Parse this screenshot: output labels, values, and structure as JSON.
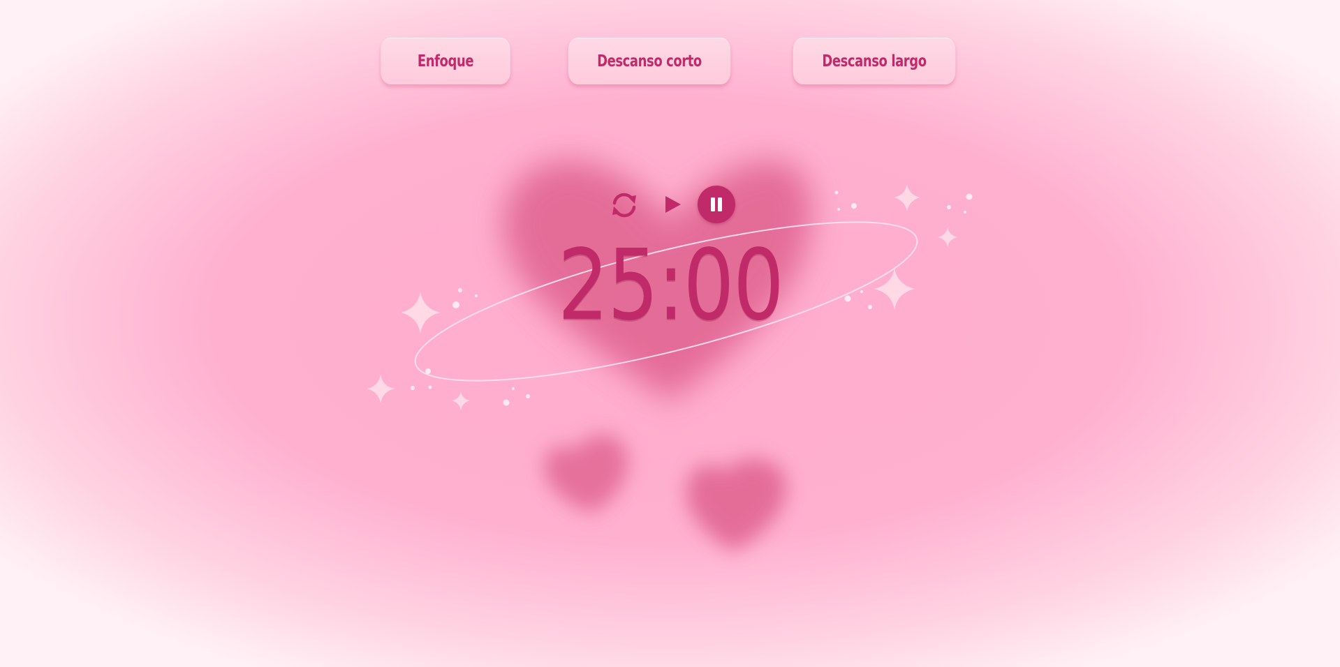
{
  "modes": {
    "focus": "Enfoque",
    "short_break": "Descanso corto",
    "long_break": "Descanso largo"
  },
  "timer": {
    "display": "25:00"
  },
  "controls": {
    "reset_icon": "reset-arrows-icon",
    "play_icon": "play-icon",
    "pause_icon": "pause-icon"
  },
  "colors": {
    "accent": "#c02a68",
    "button_bg": "#ffd3e2",
    "background": "#ffb0cf",
    "heart": "#e0628f"
  }
}
